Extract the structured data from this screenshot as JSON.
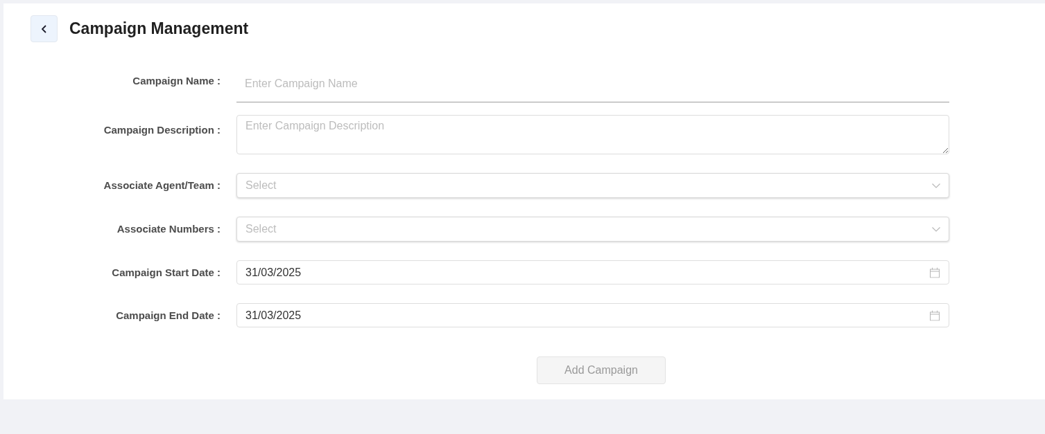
{
  "header": {
    "title": "Campaign Management"
  },
  "form": {
    "fields": [
      {
        "kind": "text",
        "label": "Campaign Name :",
        "placeholder": "Enter Campaign Name"
      },
      {
        "kind": "textarea",
        "label": "Campaign Description :",
        "placeholder": "Enter Campaign Description"
      },
      {
        "kind": "select",
        "label": "Associate Agent/Team :",
        "placeholder": "Select"
      },
      {
        "kind": "select",
        "label": "Associate Numbers :",
        "placeholder": "Select"
      },
      {
        "kind": "date",
        "label": "Campaign Start Date :",
        "value": "31/03/2025"
      },
      {
        "kind": "date",
        "label": "Campaign End Date :",
        "value": "31/03/2025"
      }
    ]
  },
  "submit_button": {
    "label": "Add Campaign",
    "disabled": true
  }
}
